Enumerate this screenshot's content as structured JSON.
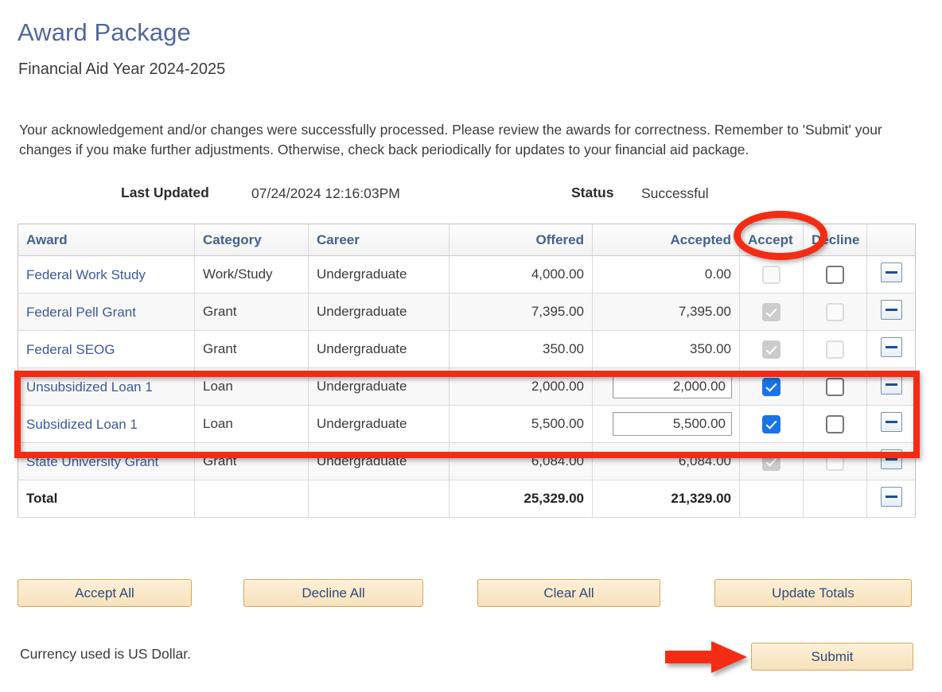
{
  "header": {
    "title": "Award Package",
    "subtitle": "Financial Aid Year 2024-2025",
    "intro": "Your acknowledgement and/or changes were successfully processed.  Please review the awards for correctness.  Remember to 'Submit' your changes if you make further adjustments. Otherwise, check back periodically for updates to your financial aid package."
  },
  "status_line": {
    "last_updated_label": "Last Updated",
    "last_updated_value": "07/24/2024 12:16:03PM",
    "status_label": "Status",
    "status_value": "Successful"
  },
  "table": {
    "columns": [
      {
        "key": "award",
        "label": "Award",
        "align": "left"
      },
      {
        "key": "category",
        "label": "Category",
        "align": "left"
      },
      {
        "key": "career",
        "label": "Career",
        "align": "left"
      },
      {
        "key": "offered",
        "label": "Offered",
        "align": "right"
      },
      {
        "key": "accepted",
        "label": "Accepted",
        "align": "right"
      },
      {
        "key": "accept",
        "label": "Accept",
        "align": "left"
      },
      {
        "key": "decline",
        "label": "Decline",
        "align": "left"
      },
      {
        "key": "action",
        "label": "",
        "align": "center"
      }
    ],
    "rows": [
      {
        "award": "Federal Work Study",
        "category": "Work/Study",
        "career": "Undergraduate",
        "offered": "4,000.00",
        "accepted": "0.00",
        "accepted_editable": false,
        "accept_checked": false,
        "accept_disabled": true,
        "decline_checked": false,
        "decline_disabled": false,
        "action_icon": "minus-icon"
      },
      {
        "award": "Federal Pell Grant",
        "category": "Grant",
        "career": "Undergraduate",
        "offered": "7,395.00",
        "accepted": "7,395.00",
        "accepted_editable": false,
        "accept_checked": true,
        "accept_disabled": true,
        "decline_checked": false,
        "decline_disabled": true,
        "action_icon": "minus-icon"
      },
      {
        "award": "Federal SEOG",
        "category": "Grant",
        "career": "Undergraduate",
        "offered": "350.00",
        "accepted": "350.00",
        "accepted_editable": false,
        "accept_checked": true,
        "accept_disabled": true,
        "decline_checked": false,
        "decline_disabled": true,
        "action_icon": "minus-icon"
      },
      {
        "award": "Unsubsidized Loan 1",
        "category": "Loan",
        "career": "Undergraduate",
        "offered": "2,000.00",
        "accepted": "2,000.00",
        "accepted_editable": true,
        "accept_checked": true,
        "accept_disabled": false,
        "decline_checked": false,
        "decline_disabled": false,
        "action_icon": "minus-icon"
      },
      {
        "award": "Subsidized Loan 1",
        "category": "Loan",
        "career": "Undergraduate",
        "offered": "5,500.00",
        "accepted": "5,500.00",
        "accepted_editable": true,
        "accept_checked": true,
        "accept_disabled": false,
        "decline_checked": false,
        "decline_disabled": false,
        "action_icon": "minus-icon"
      },
      {
        "award": "State University Grant",
        "category": "Grant",
        "career": "Undergraduate",
        "offered": "6,084.00",
        "accepted": "6,084.00",
        "accepted_editable": false,
        "accept_checked": true,
        "accept_disabled": true,
        "decline_checked": false,
        "decline_disabled": true,
        "action_icon": "minus-icon"
      }
    ],
    "total_row": {
      "award": "Total",
      "category": "",
      "career": "",
      "offered": "25,329.00",
      "accepted": "21,329.00",
      "action_icon": "minus-icon"
    }
  },
  "buttons": {
    "accept_all": "Accept All",
    "decline_all": "Decline All",
    "clear_all": "Clear All",
    "update_totals": "Update Totals",
    "submit": "Submit"
  },
  "footer": {
    "currency_note": "Currency used is US Dollar."
  },
  "annotations": {
    "color": "#f42c14",
    "ellipse_target": "Accept",
    "rect_target": "loan-rows",
    "arrow_target": "Submit"
  }
}
